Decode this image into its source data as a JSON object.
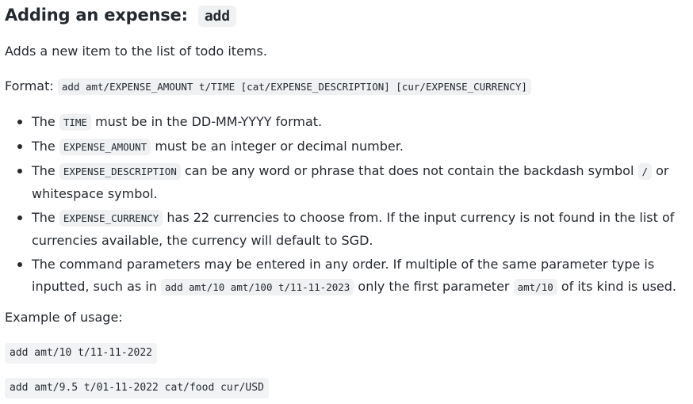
{
  "heading": {
    "text": "Adding an expense:",
    "command": "add"
  },
  "intro": "Adds a new item to the list of todo items.",
  "format": {
    "label": "Format:",
    "syntax": "add amt/EXPENSE_AMOUNT t/TIME [cat/EXPENSE_DESCRIPTION] [cur/EXPENSE_CURRENCY]"
  },
  "bullets": {
    "b1": {
      "pre": "The",
      "code": "TIME",
      "post": "must be in the DD-MM-YYYY format."
    },
    "b2": {
      "pre": "The",
      "code": "EXPENSE_AMOUNT",
      "post": "must be an integer or decimal number."
    },
    "b3": {
      "pre": "The",
      "code": "EXPENSE_DESCRIPTION",
      "mid": "can be any word or phrase that does not contain the backdash symbol",
      "code2": "/",
      "post": "or whitespace symbol."
    },
    "b4": {
      "pre": "The",
      "code": "EXPENSE_CURRENCY",
      "post": "has 22 currencies to choose from. If the input currency is not found in the list of currencies available, the currency will default to SGD."
    },
    "b5": {
      "pre": "The command parameters may be entered in any order. If multiple of the same parameter type is inputted, such as in",
      "code": "add amt/10 amt/100 t/11-11-2023",
      "mid": "only the first parameter",
      "code2": "amt/10",
      "post": "of its kind is used."
    }
  },
  "example": {
    "label": "Example of usage:",
    "cmd1": "add amt/10 t/11-11-2022",
    "cmd2": "add amt/9.5 t/01-11-2022 cat/food cur/USD"
  }
}
